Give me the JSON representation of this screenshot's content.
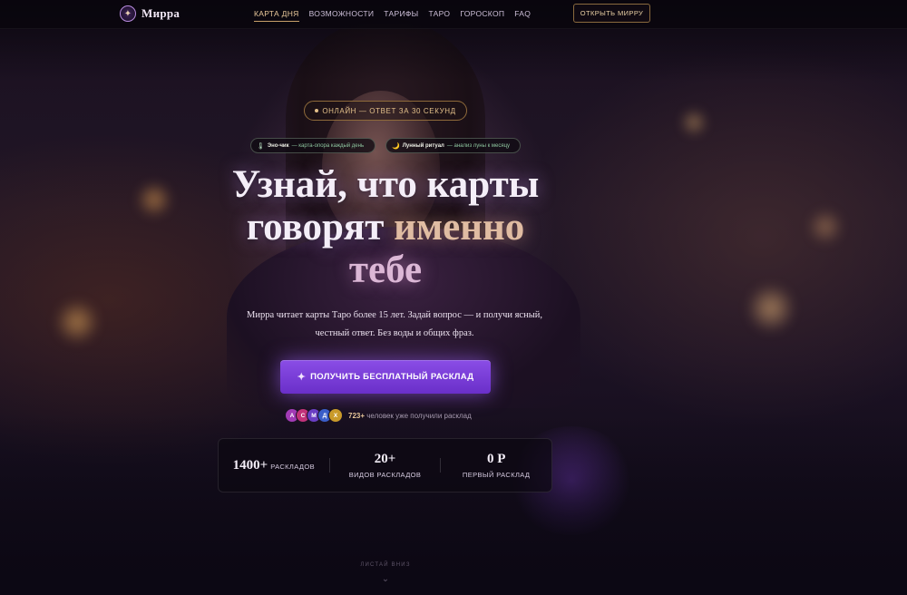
{
  "brand": {
    "name": "Мирра",
    "logo_glyph": "✦"
  },
  "nav": {
    "items": [
      {
        "label": "КАРТА ДНЯ",
        "active": true
      },
      {
        "label": "ВОЗМОЖНОСТИ",
        "active": false
      },
      {
        "label": "ТАРИФЫ",
        "active": false
      },
      {
        "label": "ТАРО",
        "active": false
      },
      {
        "label": "ГОРОСКОП",
        "active": false
      },
      {
        "label": "FAQ",
        "active": false
      }
    ],
    "cta_label": "ОТКРЫТЬ МИРРУ"
  },
  "hero": {
    "status": "ОНЛАЙН — ОТВЕТ ЗА 30 СЕКУНД",
    "chips": [
      {
        "icon": "thermometer-icon",
        "glyph": "🌡",
        "strong": "Эно-чик",
        "rest": "— карта-опора каждый день"
      },
      {
        "icon": "moon-icon",
        "glyph": "🌙",
        "strong": "Лунный ритуал",
        "rest": "— анализ луны к месяцу"
      }
    ],
    "headline_line1": "Узнай, что карты",
    "headline_line2_a": "говорят ",
    "headline_line2_b": "именно",
    "headline_line3": "тебе",
    "subtitle": "Мирра читает карты Таро более 15 лет. Задай вопрос — и получи ясный, честный ответ. Без воды и общих фраз.",
    "cta_label": "ПОЛУЧИТЬ БЕСПЛАТНЫЙ РАСКЛАД",
    "social": {
      "avatars": [
        {
          "letter": "А",
          "color": "#a23bb5"
        },
        {
          "letter": "С",
          "color": "#c2327a"
        },
        {
          "letter": "М",
          "color": "#6a3fc4"
        },
        {
          "letter": "Д",
          "color": "#3a5ec9"
        },
        {
          "letter": "Х",
          "color": "#c99a2a"
        }
      ],
      "count": "723+",
      "text": " человек уже получили расклад"
    }
  },
  "stats": [
    {
      "value": "1400+",
      "label": "РАСКЛАДОВ",
      "inline": true
    },
    {
      "value": "20+",
      "label": "ВИДОВ РАСКЛАДОВ",
      "inline": false
    },
    {
      "value": "0 Р",
      "label": "ПЕРВЫЙ РАСКЛАД",
      "inline": false
    }
  ],
  "scroll_hint": "ЛИСТАЙ ВНИЗ",
  "colors": {
    "accent_gold": "#e8c79a",
    "cta_purple": "#7b3fe0",
    "bg_dark": "#0b0712"
  }
}
